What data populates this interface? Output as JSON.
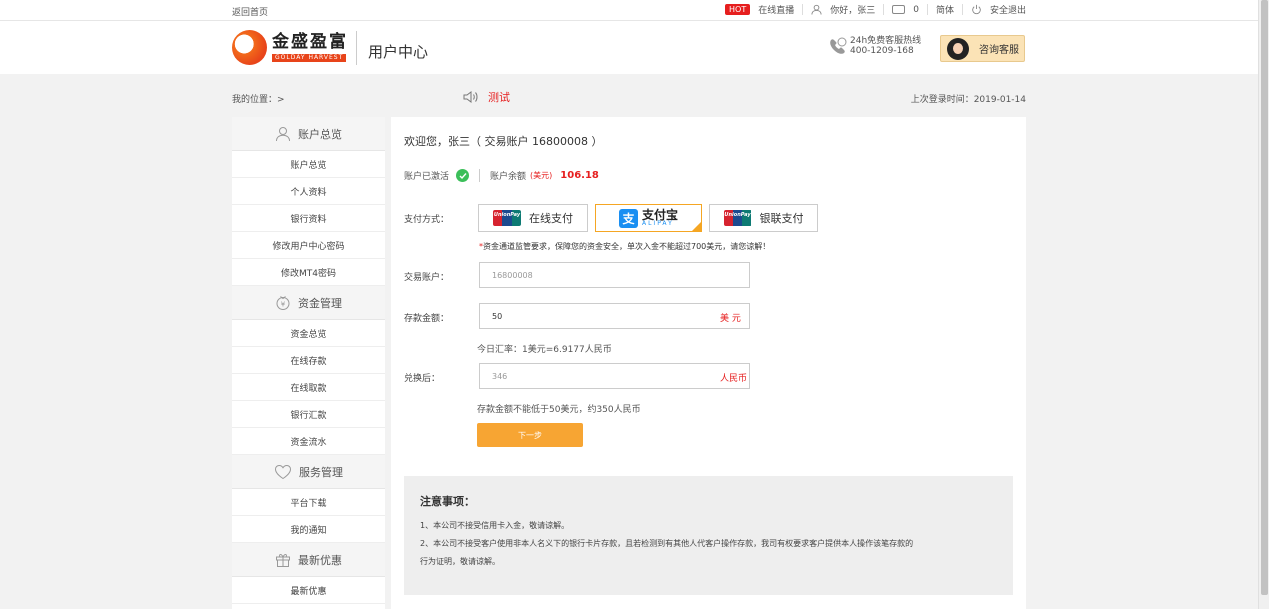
{
  "topbar": {
    "back_home": "返回首页",
    "hot_badge": "HOT",
    "live": "在线直播",
    "greeting": "你好，张三",
    "messages": "0",
    "lang": "简体",
    "logout": "安全退出"
  },
  "header": {
    "logo_cn": "金盛盈富",
    "logo_en": "GOLDAY HARVEST",
    "title": "用户中心",
    "hotline_label": "24h免费客服热线",
    "hotline_number": "400-1209-168",
    "cs_button": "咨询客服"
  },
  "crumb": {
    "location": "我的位置：>",
    "notice": "测试",
    "last_login": "上次登录时间：2019-01-14"
  },
  "sidebar": {
    "sections": [
      {
        "title": "账户总览",
        "icon": "user-icon",
        "items": [
          "账户总览",
          "个人资料",
          "银行资料",
          "修改用户中心密码",
          "修改MT4密码"
        ]
      },
      {
        "title": "资金管理",
        "icon": "money-icon",
        "items": [
          "资金总览",
          "在线存款",
          "在线取款",
          "银行汇款",
          "资金流水"
        ]
      },
      {
        "title": "服务管理",
        "icon": "heart-icon",
        "items": [
          "平台下载",
          "我的通知"
        ]
      },
      {
        "title": "最新优惠",
        "icon": "gift-icon",
        "items": [
          "最新优惠"
        ]
      }
    ]
  },
  "main": {
    "welcome": "欢迎您，张三（ 交易账户 16800008 ）",
    "activated": "账户已激活",
    "balance_label": "账户余额",
    "balance_currency": "(美元)",
    "balance_value": "106.18",
    "pay_label": "支付方式：",
    "pay_methods": {
      "online_text": "在线支付",
      "alipay_cn": "支付宝",
      "alipay_en": "ALIPAY",
      "unionpay_text": "银联支付",
      "unionpay_logo_en": "UnionPay",
      "unionpay_logo_cn": "银联"
    },
    "tip": "资金通道监管要求，保障您的资金安全，单次入金不能超过700美元，请您谅解！",
    "tip_star": "*",
    "account_label": "交易账户：",
    "account_value": "16800008",
    "amount_label": "存款金额：",
    "amount_value": "50",
    "amount_unit": "美 元",
    "rate": "今日汇率：1美元=6.9177人民币",
    "converted_label": "兑换后：",
    "converted_value": "346",
    "converted_unit": "人民币",
    "min_hint": "存款金额不能低于50美元，约350人民币",
    "next_button": "下一步",
    "notes_title": "注意事项：",
    "notes": [
      "1、本公司不接受信用卡入金，敬请谅解。",
      "2、本公司不接受客户使用非本人名义下的银行卡片存款，且若检测到有其他人代客户操作存款，我司有权要求客户提供本人操作该笔存款的",
      "行为证明，敬请谅解。"
    ]
  },
  "colors": {
    "accent_orange": "#f7a533",
    "alert_red": "#e61e1e",
    "success_green": "#3cbf5a",
    "alipay_blue": "#1a8ff2"
  }
}
